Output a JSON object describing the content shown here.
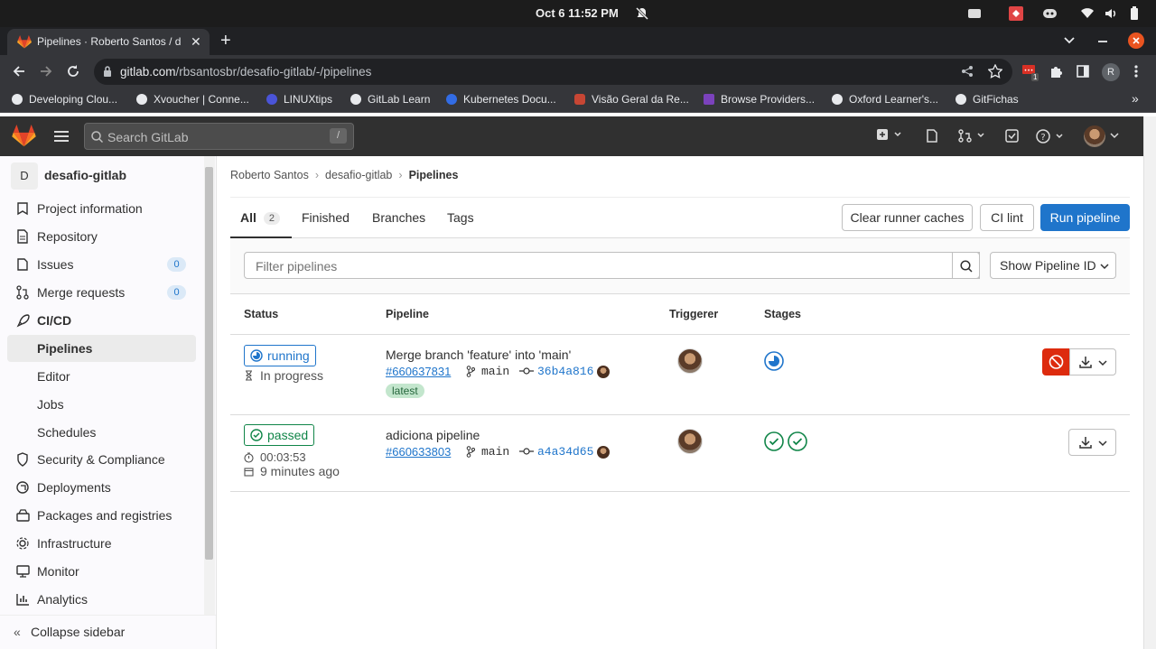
{
  "os": {
    "clock": "Oct 6  11:52 PM"
  },
  "browser": {
    "tab_title": "Pipelines · Roberto Santos / d",
    "url_host": "gitlab.com",
    "url_path": "/rbsantosbr/desafio-gitlab/-/pipelines",
    "profile_initial": "R",
    "ext_badge": "1",
    "bookmarks": [
      {
        "label": "Developing Clou..."
      },
      {
        "label": "Xvoucher | Conne..."
      },
      {
        "label": "LINUXtips"
      },
      {
        "label": "GitLab Learn"
      },
      {
        "label": "Kubernetes Docu..."
      },
      {
        "label": "Visão Geral da Re..."
      },
      {
        "label": "Browse Providers..."
      },
      {
        "label": "Oxford Learner's..."
      },
      {
        "label": "GitFichas"
      }
    ]
  },
  "header": {
    "search_placeholder": "Search GitLab",
    "search_shortcut": "/"
  },
  "sidebar": {
    "project_initial": "D",
    "project_name": "desafio-gitlab",
    "items": [
      {
        "label": "Project information"
      },
      {
        "label": "Repository"
      },
      {
        "label": "Issues",
        "count": "0"
      },
      {
        "label": "Merge requests",
        "count": "0"
      },
      {
        "label": "CI/CD"
      },
      {
        "label": "Pipelines"
      },
      {
        "label": "Editor"
      },
      {
        "label": "Jobs"
      },
      {
        "label": "Schedules"
      },
      {
        "label": "Security & Compliance"
      },
      {
        "label": "Deployments"
      },
      {
        "label": "Packages and registries"
      },
      {
        "label": "Infrastructure"
      },
      {
        "label": "Monitor"
      },
      {
        "label": "Analytics"
      }
    ],
    "collapse_label": "Collapse sidebar"
  },
  "breadcrumb": [
    "Roberto Santos",
    "desafio-gitlab",
    "Pipelines"
  ],
  "tabs": [
    {
      "label": "All",
      "count": "2"
    },
    {
      "label": "Finished"
    },
    {
      "label": "Branches"
    },
    {
      "label": "Tags"
    }
  ],
  "actions": {
    "clear_caches": "Clear runner caches",
    "ci_lint": "CI lint",
    "run_pipeline": "Run pipeline"
  },
  "filter": {
    "placeholder": "Filter pipelines",
    "show_id": "Show Pipeline ID"
  },
  "table": {
    "headers": {
      "status": "Status",
      "pipeline": "Pipeline",
      "triggerer": "Triggerer",
      "stages": "Stages"
    },
    "rows": [
      {
        "status": "running",
        "status_detail": "In progress",
        "message": "Merge branch 'feature' into 'main'",
        "id": "#660637831",
        "branch": "main",
        "sha": "36b4a816",
        "tag": "latest"
      },
      {
        "status": "passed",
        "duration": "00:03:53",
        "finished": "9 minutes ago",
        "message": "adiciona pipeline",
        "id": "#660633803",
        "branch": "main",
        "sha": "a4a34d65"
      }
    ]
  },
  "colors": {
    "primary": "#1f75cb",
    "success": "#108548",
    "danger": "#dd2b0e",
    "header": "#303030"
  }
}
